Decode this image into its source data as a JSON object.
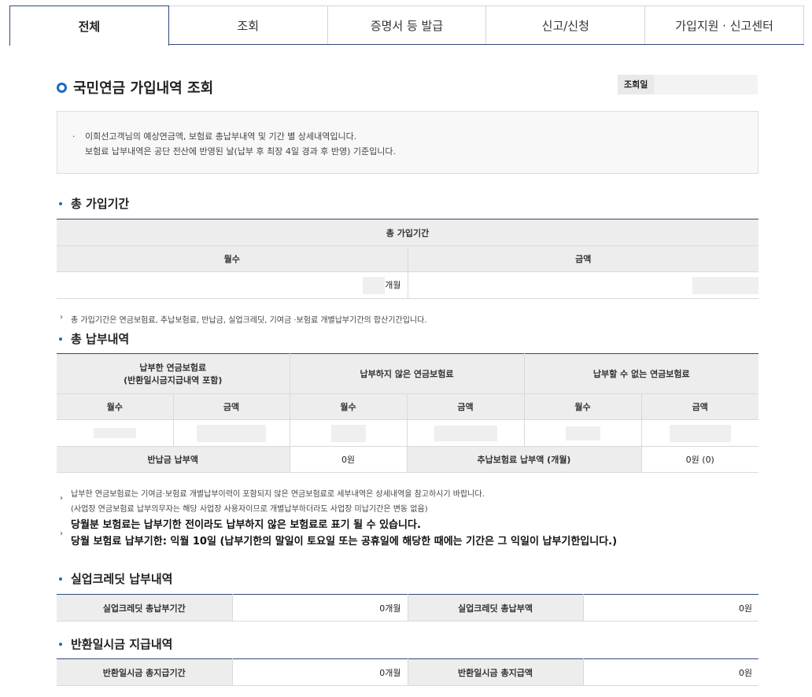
{
  "tabs": [
    "전체",
    "조회",
    "증명서 등 발급",
    "신고/신청",
    "가입지원 · 신고센터"
  ],
  "page_title": "국민연금 가입내역 조회",
  "date_label": "조회일",
  "notice": {
    "line1": "이희선고객님의 예상연금액, 보험료 총납부내역 및 기간 별 상세내역입니다.",
    "line2": "보험료 납부내역은 공단 전산에 반영된 날(납부 후 최장 4일 경과 후 반영) 기준입니다."
  },
  "sections": {
    "total_period": "총 가입기간",
    "total_payment": "총 납부내역",
    "unemployment": "실업크레딧 납부내역",
    "refund": "반환일시금 지급내역"
  },
  "period_table": {
    "header": "총 가입기간",
    "col_months": "월수",
    "col_amount": "금액",
    "months_unit": "개월"
  },
  "period_note": "총 가입기간은 연금보험료, 추납보험료, 반납금, 실업크레딧, 기여금 ·보험료 개별납부기간의 합산기간입니다.",
  "payment_table": {
    "group1_line1": "납부한 연금보험료",
    "group1_line2": "(반환일시금지급내역 포함)",
    "group2": "납부하지 않은 연금보험료",
    "group3": "납부할 수 없는 연금보험료",
    "col_months": "월수",
    "col_amount": "금액",
    "return_label": "반납금 납부액",
    "return_value": "0원",
    "addpay_label": "추납보험료 납부액 (개월)",
    "addpay_value": "0원 (0)"
  },
  "payment_note": {
    "line1": "납부한 연금보험료는 기여금·보험료 개별납부이력이 포함되지 않은 연금보험료로 세부내역은 상세내역을 참고하시기 바랍니다.",
    "line2": "(사업장 연금보험료 납부의무자는 해당 사업장 사용자이므로 개별납부하더라도 사업장 미납기간은 변동 없음)",
    "bold1": "당월분 보험료는 납부기한 전이라도 납부하지 않은 보험료로 표기 될 수 있습니다.",
    "bold2": "당월 보험료 납부기한: 익월 10일 (납부기한의 말일이 토요일 또는 공휴일에 해당한 때에는 기간은 그 익일이 납부기한입니다.)"
  },
  "unemployment_table": {
    "label1": "실업크레딧 총납부기간",
    "value1": "0개월",
    "label2": "실업크레딧 총납부액",
    "value2": "0원"
  },
  "refund_table": {
    "label1": "반환일시금 총지급기간",
    "value1": "0개월",
    "label2": "반환일시금 총지급액",
    "value2": "0원"
  }
}
